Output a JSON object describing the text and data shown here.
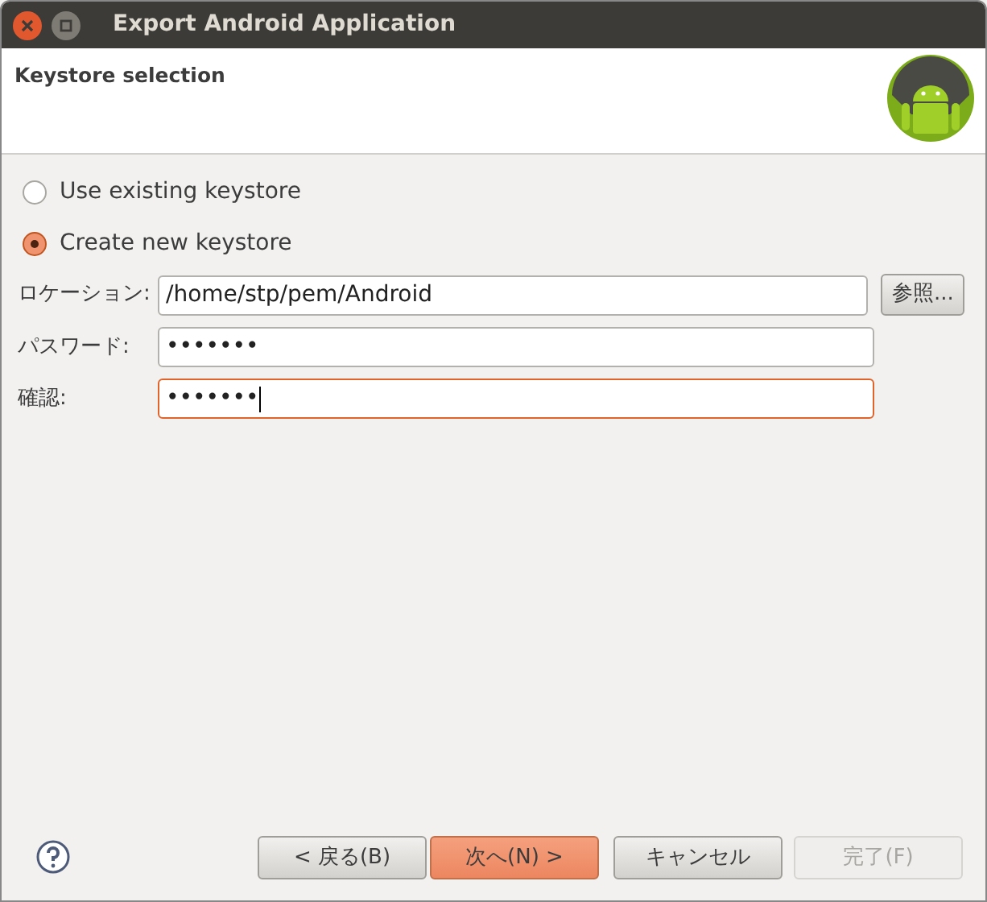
{
  "window": {
    "title": "Export Android Application"
  },
  "header": {
    "title": "Keystore selection"
  },
  "options": [
    {
      "label": "Use existing keystore",
      "selected": false
    },
    {
      "label": "Create new keystore",
      "selected": true
    }
  ],
  "fields": [
    {
      "label": "ロケーション:",
      "value": "/home/stp/pem/Android",
      "focused": false,
      "button": "参照..."
    },
    {
      "label": "パスワード:",
      "value": "•••••••",
      "focused": false
    },
    {
      "label": "確認:",
      "value": "•••••••",
      "focused": true
    }
  ],
  "buttons": [
    {
      "label": "< 戻る(B)",
      "kind": "normal",
      "disabled": false
    },
    {
      "label": "次へ(N) >",
      "kind": "default",
      "disabled": false
    },
    {
      "label": "キャンセル",
      "kind": "normal",
      "disabled": false
    },
    {
      "label": "完了(F)",
      "kind": "normal",
      "disabled": true
    }
  ]
}
